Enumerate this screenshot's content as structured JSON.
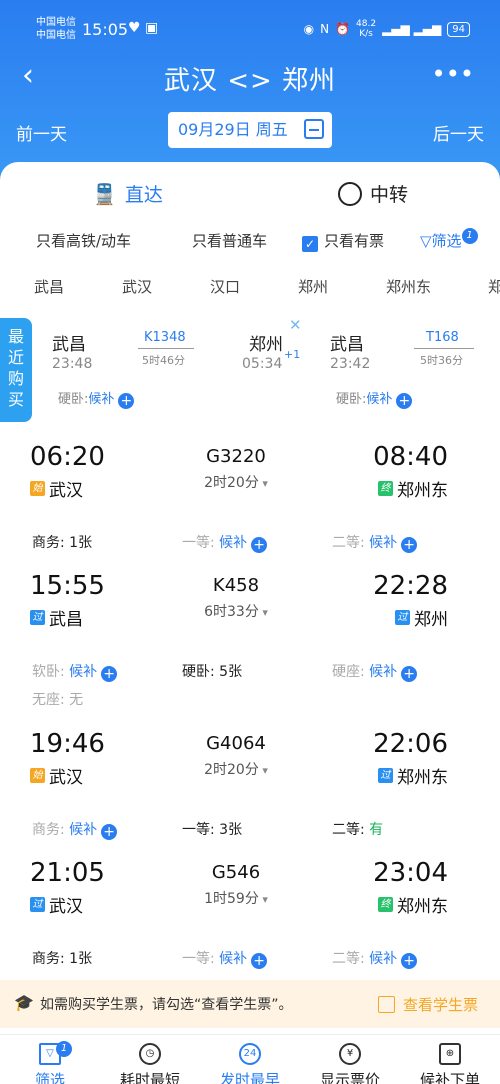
{
  "status": {
    "carrier1": "中国电信",
    "carrier2": "中国电信",
    "time": "15:05",
    "speed": "48.2",
    "speed_unit": "K/s",
    "battery": "94"
  },
  "nav": {
    "title": "武汉 <> 郑州"
  },
  "dates": {
    "prev": "前一天",
    "current": "09月29日 周五",
    "next": "后一天"
  },
  "modes": {
    "direct": "直达",
    "transfer": "中转"
  },
  "filters": {
    "high_speed": "只看高铁/动车",
    "normal": "只看普通车",
    "available": "只看有票",
    "screen": "筛选",
    "screen_badge": "1"
  },
  "stations": [
    "武昌",
    "武汉",
    "汉口",
    "郑州",
    "郑州东",
    "郑"
  ],
  "recent": {
    "tab": [
      "最",
      "近",
      "购",
      "买"
    ],
    "a": {
      "from": "武昌",
      "dep": "23:48",
      "no": "K1348",
      "dur": "5时46分",
      "to": "郑州",
      "arr": "05:34",
      "plus": "+1",
      "seat": "硬卧:",
      "status": "候补"
    },
    "b": {
      "from": "武昌",
      "dep": "23:42",
      "no": "T168",
      "dur": "5时36分",
      "seat": "硬卧:",
      "status": "候补"
    }
  },
  "trains": [
    {
      "dep": "06:20",
      "arr": "08:40",
      "no": "G3220",
      "dur": "2时20分",
      "from_tag": "始",
      "from": "武汉",
      "to_tag": "终",
      "to": "郑州东",
      "seats": [
        {
          "k": "商务:",
          "v": "1张"
        },
        {
          "k": "一等:",
          "v": "候补"
        },
        {
          "k": "二等:",
          "v": "候补"
        }
      ]
    },
    {
      "dep": "15:55",
      "arr": "22:28",
      "no": "K458",
      "dur": "6时33分",
      "from_tag": "过",
      "from": "武昌",
      "to_tag": "过",
      "to": "郑州",
      "seats": [
        {
          "k": "软卧:",
          "v": "候补"
        },
        {
          "k": "硬卧:",
          "v": "5张"
        },
        {
          "k": "硬座:",
          "v": "候补"
        },
        {
          "k": "无座:",
          "v": "无"
        }
      ]
    },
    {
      "dep": "19:46",
      "arr": "22:06",
      "no": "G4064",
      "dur": "2时20分",
      "from_tag": "始",
      "from": "武汉",
      "to_tag": "过",
      "to": "郑州东",
      "seats": [
        {
          "k": "商务:",
          "v": "候补"
        },
        {
          "k": "一等:",
          "v": "3张"
        },
        {
          "k": "二等:",
          "v": "有"
        }
      ]
    },
    {
      "dep": "21:05",
      "arr": "23:04",
      "no": "G546",
      "dur": "1时59分",
      "from_tag": "过",
      "from": "武汉",
      "to_tag": "终",
      "to": "郑州东",
      "seats": [
        {
          "k": "商务:",
          "v": "1张"
        },
        {
          "k": "一等:",
          "v": "候补"
        },
        {
          "k": "二等:",
          "v": "候补"
        }
      ]
    }
  ],
  "notice": {
    "text": "如需购买学生票，请勾选“查看学生票”。",
    "check_label": "查看学生票"
  },
  "bottom": {
    "filter": "筛选",
    "filter_badge": "1",
    "shortest": "耗时最短",
    "earliest": "发时最早",
    "earliest_icon": "24",
    "price": "显示票价",
    "waitlist": "候补下单"
  }
}
